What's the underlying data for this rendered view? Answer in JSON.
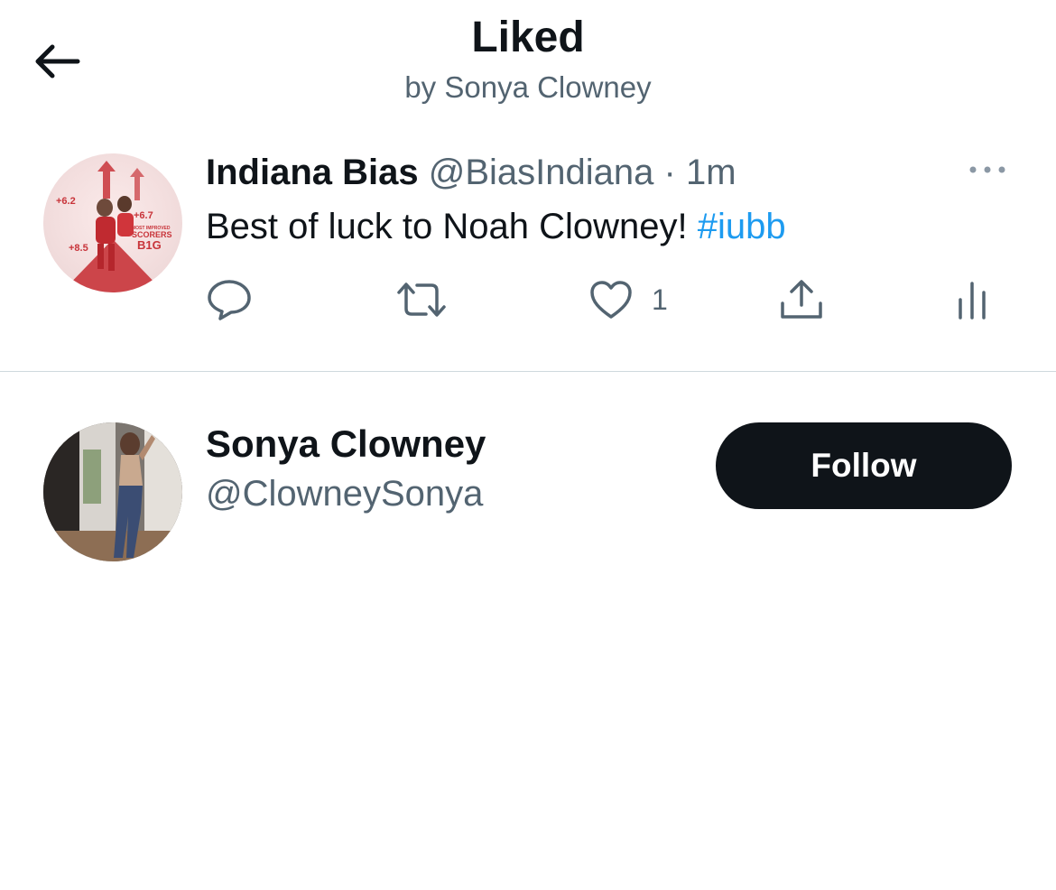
{
  "header": {
    "title": "Liked",
    "subtitle": "by Sonya Clowney"
  },
  "tweet": {
    "author_name": "Indiana Bias",
    "author_handle": "@BiasIndiana",
    "separator": "·",
    "time": "1m",
    "text": "Best of luck to Noah Clowney! ",
    "hashtag": "#iubb",
    "avatar": {
      "overlay_text": [
        "+6.2",
        "+6.7",
        "+8.5",
        "MOST IMPROVED",
        "SCORERS",
        "B1G"
      ]
    },
    "actions": {
      "reply_icon": "reply-icon",
      "retweet_icon": "retweet-icon",
      "like_icon": "heart-icon",
      "like_count": "1",
      "share_icon": "share-icon",
      "analytics_icon": "analytics-icon"
    }
  },
  "user": {
    "name": "Sonya Clowney",
    "handle": "@ClowneySonya",
    "follow_label": "Follow"
  },
  "colors": {
    "text": "#0f1419",
    "secondary": "#536471",
    "link": "#1d9bf0",
    "divider": "#cfd9de",
    "button_bg": "#0f1419",
    "button_text": "#ffffff"
  }
}
